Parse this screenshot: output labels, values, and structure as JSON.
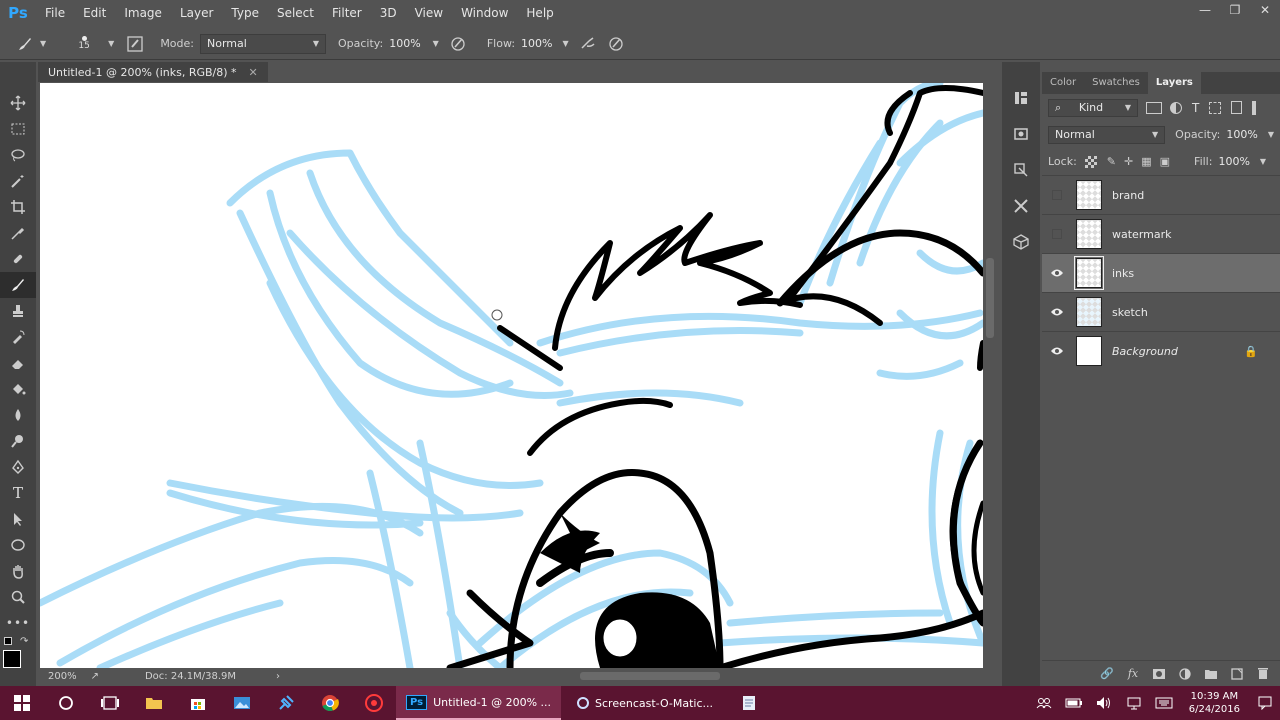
{
  "app": {
    "logo": "Ps"
  },
  "menu": [
    "File",
    "Edit",
    "Image",
    "Layer",
    "Type",
    "Select",
    "Filter",
    "3D",
    "View",
    "Window",
    "Help"
  ],
  "options": {
    "brush_size": "15",
    "mode_label": "Mode:",
    "mode_value": "Normal",
    "opacity_label": "Opacity:",
    "opacity_value": "100%",
    "flow_label": "Flow:",
    "flow_value": "100%"
  },
  "document": {
    "tab_title": "Untitled-1 @ 200% (inks, RGB/8) *",
    "zoom": "200%",
    "doc_info": "Doc: 24.1M/38.9M"
  },
  "panel": {
    "tabs": [
      "Color",
      "Swatches",
      "Layers"
    ],
    "active_tab": "Layers",
    "filter_label": "Kind",
    "blend_mode": "Normal",
    "opacity_label": "Opacity:",
    "opacity_value": "100%",
    "lock_label": "Lock:",
    "fill_label": "Fill:",
    "fill_value": "100%",
    "layers": [
      {
        "name": "brand",
        "visible": false,
        "selected": false,
        "italic": false
      },
      {
        "name": "watermark",
        "visible": false,
        "selected": false,
        "italic": false
      },
      {
        "name": "inks",
        "visible": true,
        "selected": true,
        "italic": false
      },
      {
        "name": "sketch",
        "visible": true,
        "selected": false,
        "italic": false
      },
      {
        "name": "Background",
        "visible": true,
        "selected": false,
        "italic": true,
        "locked": true
      }
    ]
  },
  "taskbar": {
    "apps": [
      {
        "label": "Untitled-1 @ 200% ...",
        "active": true
      },
      {
        "label": "Screencast-O-Matic...",
        "active": false
      }
    ],
    "time": "10:39 AM",
    "date": "6/24/2016"
  },
  "colors": {
    "sketch_blue": "#a9dcf7",
    "ink": "#000000",
    "taskbar": "#5a1430",
    "ps_blue": "#31a8ff"
  }
}
